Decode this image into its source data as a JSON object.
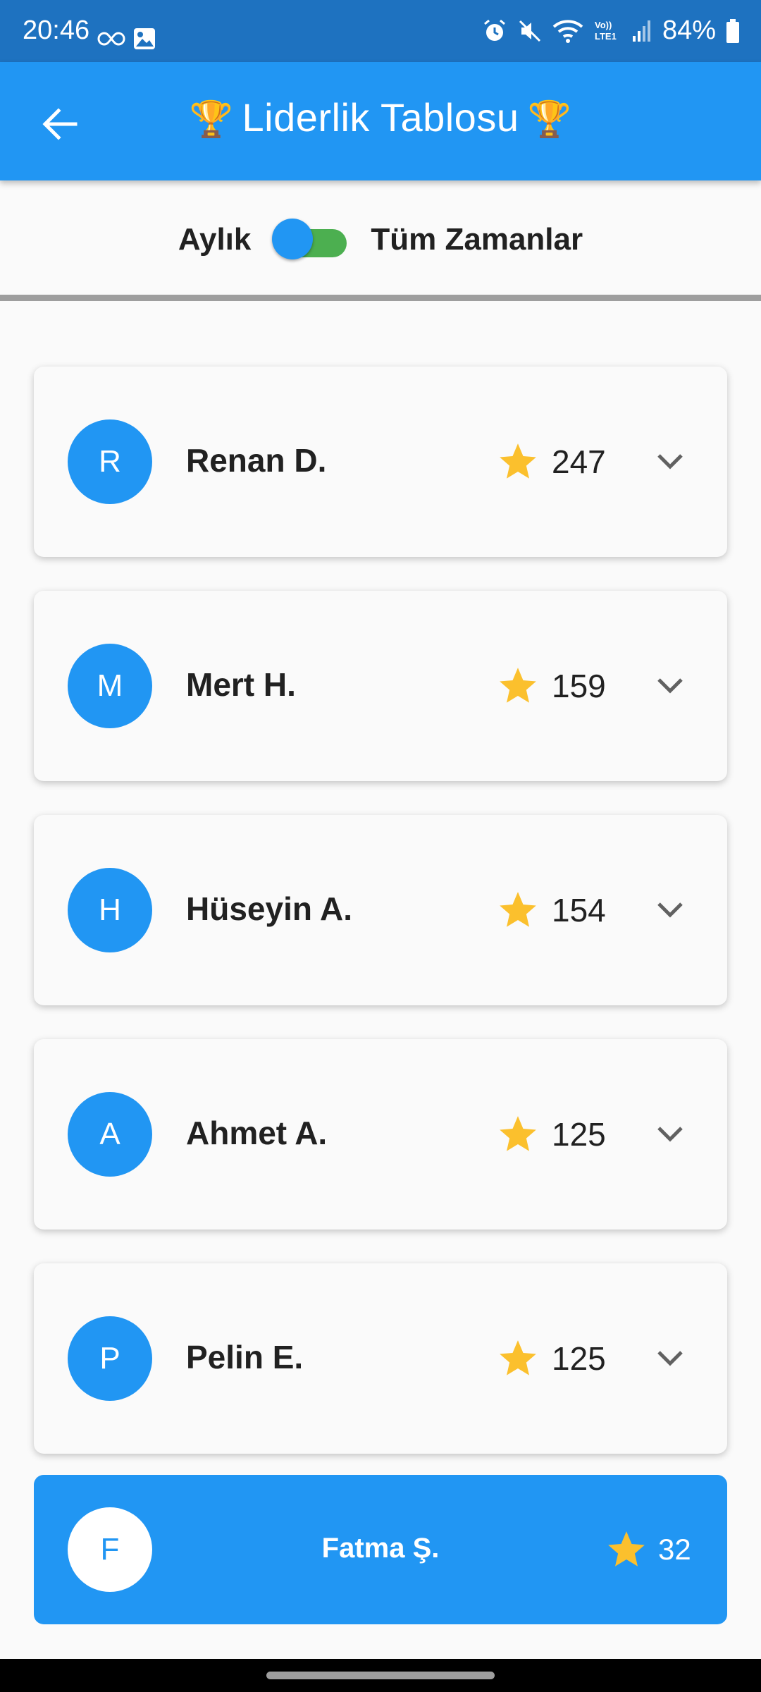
{
  "status_bar": {
    "time": "20:46",
    "left_icons": [
      "link-icon",
      "image-icon"
    ],
    "right_icons": [
      "alarm-icon",
      "mute-icon",
      "wifi-icon",
      "volte-icon",
      "signal-icon"
    ],
    "volte_text": "Vo))\nLTE1",
    "battery": "84%"
  },
  "app_bar": {
    "title": "Liderlik Tablosu",
    "trophy": "🏆"
  },
  "toggle": {
    "left_label": "Aylık",
    "right_label": "Tüm Zamanlar",
    "state": "Tüm Zamanlar"
  },
  "leaderboard": [
    {
      "initial": "R",
      "name": "Renan D.",
      "score": "247"
    },
    {
      "initial": "M",
      "name": "Mert H.",
      "score": "159"
    },
    {
      "initial": "H",
      "name": "Hüseyin A.",
      "score": "154"
    },
    {
      "initial": "A",
      "name": "Ahmet A.",
      "score": "125"
    },
    {
      "initial": "P",
      "name": "Pelin E.",
      "score": "125"
    }
  ],
  "current_user": {
    "initial": "F",
    "name": "Fatma Ş.",
    "score": "32"
  },
  "colors": {
    "primary": "#2196f3",
    "status_bar": "#1e72c0",
    "switch_track": "#4caf50",
    "star": "#fbc02d"
  }
}
